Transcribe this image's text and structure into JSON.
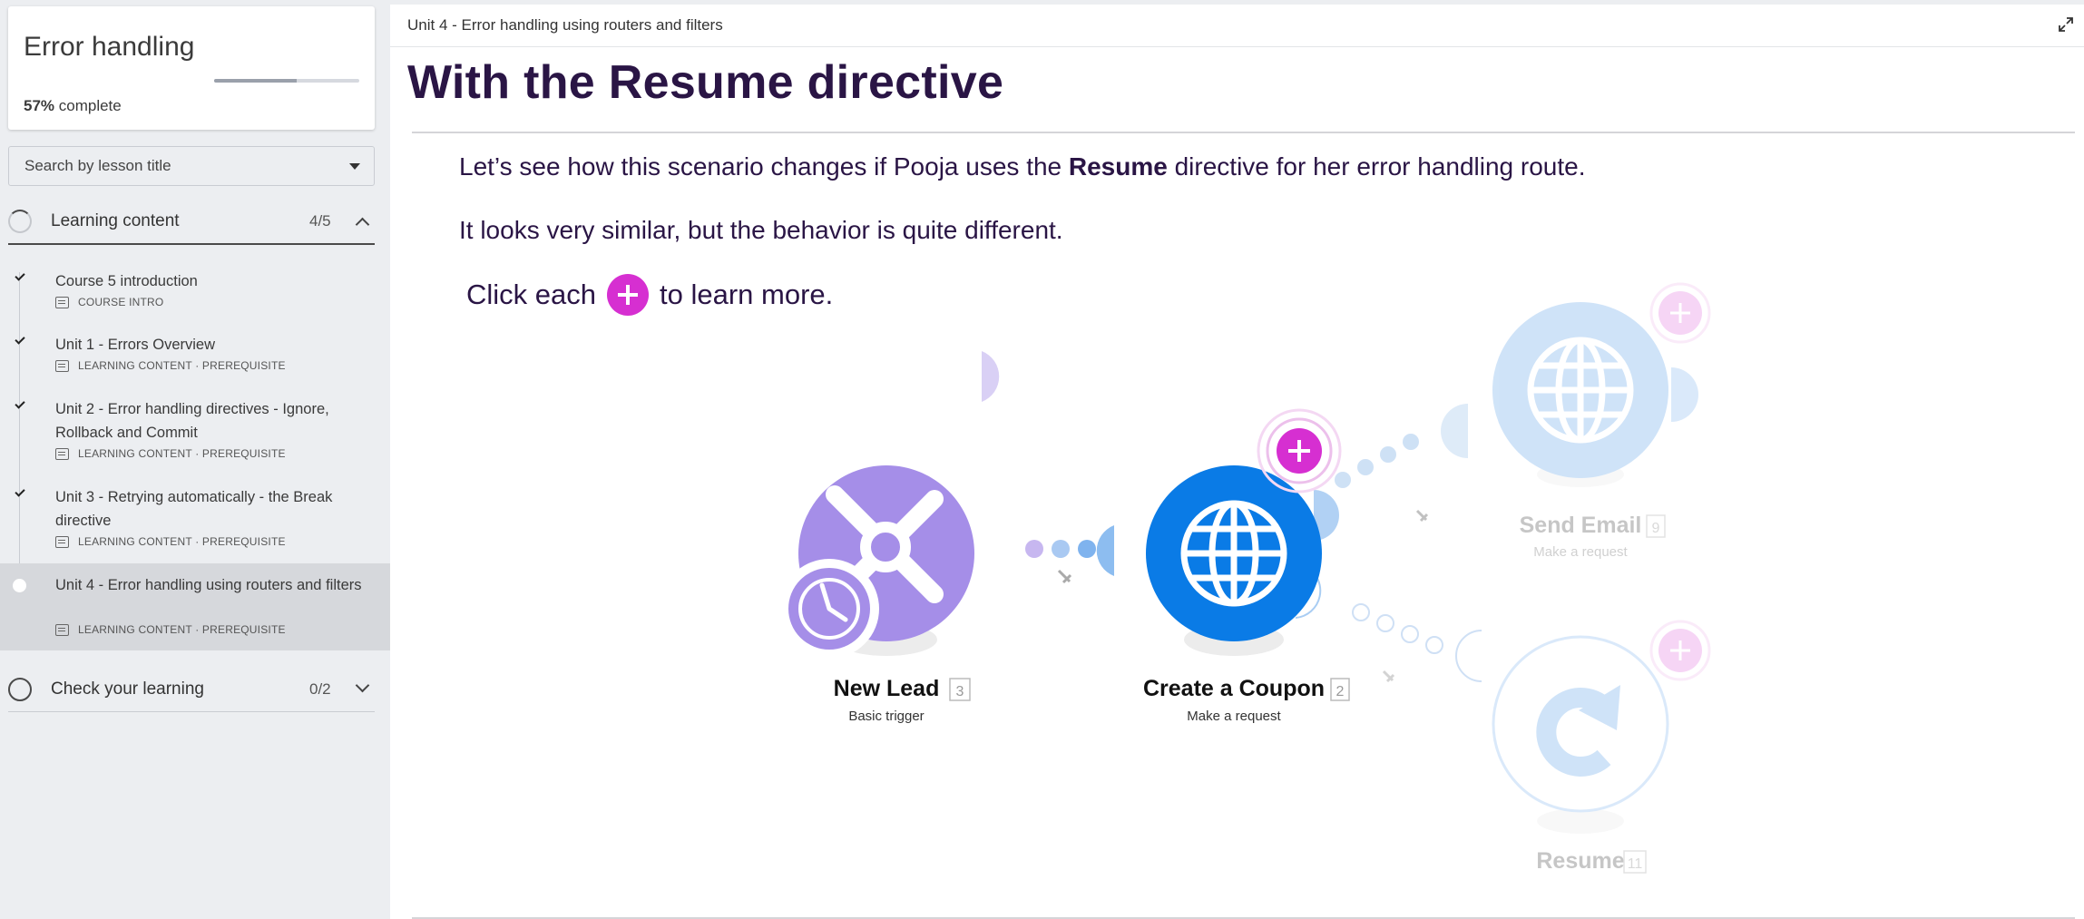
{
  "sidebar": {
    "course_title": "Error handling",
    "progress_percent": 57,
    "progress_value": "57%",
    "progress_suffix": " complete",
    "search_placeholder": "Search by lesson title",
    "sections": [
      {
        "title": "Learning content",
        "count": "4/5"
      },
      {
        "title": "Check your learning",
        "count": "0/2"
      }
    ],
    "lessons": [
      {
        "title": "Course 5 introduction",
        "meta": "COURSE INTRO",
        "status": "complete"
      },
      {
        "title": "Unit 1 - Errors Overview",
        "meta": "LEARNING CONTENT · PREREQUISITE",
        "status": "complete"
      },
      {
        "title": "Unit 2 - Error handling directives - Ignore, Rollback and Commit",
        "meta": "LEARNING CONTENT · PREREQUISITE",
        "status": "complete"
      },
      {
        "title": "Unit 3 - Retrying automatically - the Break directive",
        "meta": "LEARNING CONTENT · PREREQUISITE",
        "status": "complete"
      },
      {
        "title": "Unit 4 - Error handling using routers and filters",
        "meta": "LEARNING CONTENT · PREREQUISITE",
        "status": "active"
      }
    ]
  },
  "main": {
    "breadcrumb": "Unit 4 - Error handling using routers and filters",
    "title": "With the Resume directive",
    "para1_pre": "Let’s see how this scenario changes if Pooja uses the ",
    "para1_bold": "Resume",
    "para1_post": " directive for her error handling route.",
    "para2": "It looks very similar, but the behavior is quite different.",
    "click_pre": "Click each",
    "click_post": "to learn more."
  },
  "scenario": {
    "modules": [
      {
        "name": "New Lead",
        "id": "3",
        "subtitle": "Basic trigger",
        "icon": "tools-clock-icon"
      },
      {
        "name": "Create a Coupon",
        "id": "2",
        "subtitle": "Make a request",
        "icon": "globe-icon"
      },
      {
        "name": "Send Email",
        "id": "9",
        "subtitle": "Make a request",
        "icon": "globe-icon"
      },
      {
        "name": "Resume",
        "id": "11",
        "subtitle": "",
        "icon": "resume-arrow-icon"
      }
    ]
  },
  "colors": {
    "title_text": "#2a1545",
    "accent_plus": "#d62fd1",
    "trigger_purple": "#a58ee8",
    "http_blue": "#0a7be6",
    "faded_blue": "#cfe4f9"
  }
}
